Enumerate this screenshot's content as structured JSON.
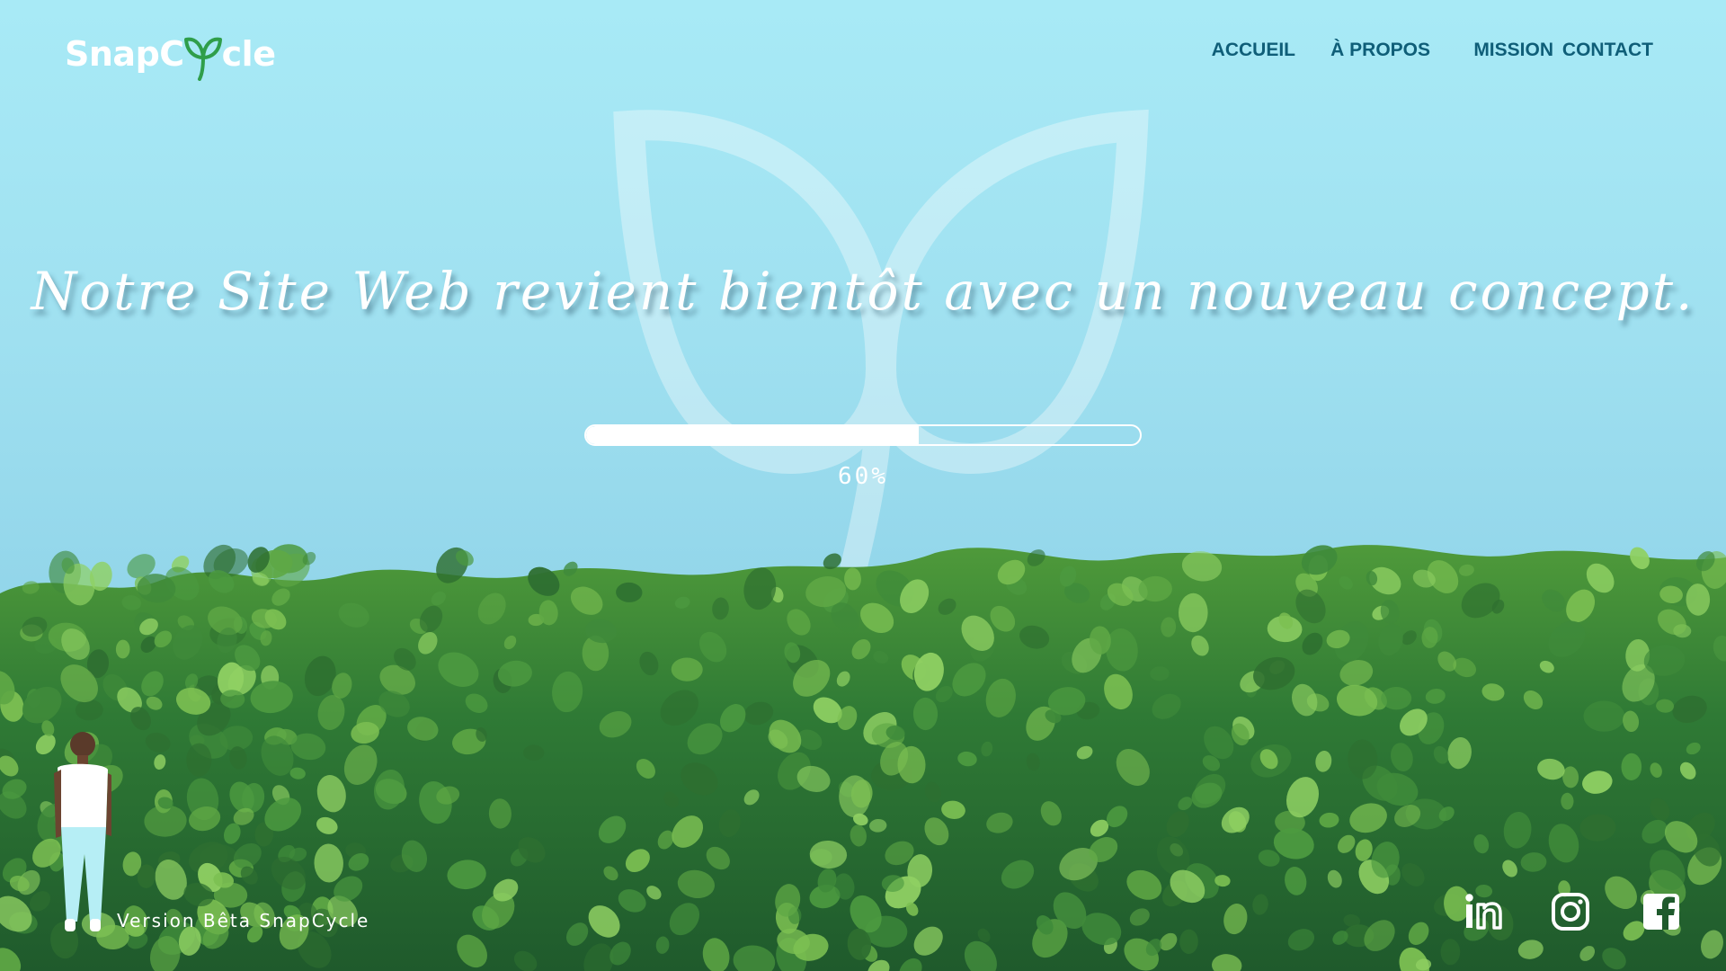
{
  "brand": {
    "logo_prefix": "SnapC",
    "logo_suffix": "cle",
    "logo_icon": "leaf-y-icon",
    "logo_accent": "#2f9e4a"
  },
  "nav": {
    "items": [
      {
        "label": "ACCUEIL"
      },
      {
        "label": "À PROPOS"
      },
      {
        "label": "MISSION"
      },
      {
        "label": "CONTACT"
      }
    ],
    "color": "#0f5e78"
  },
  "hero": {
    "headline": "Notre Site Web revient bientôt avec un nouveau concept.",
    "progress": {
      "value": 0.6,
      "label": "60%"
    }
  },
  "footer": {
    "version_text": "Version Bêta SnapCycle",
    "social": [
      {
        "icon": "linkedin-icon"
      },
      {
        "icon": "instagram-icon"
      },
      {
        "icon": "facebook-icon"
      }
    ]
  },
  "colors": {
    "sky_top": "#a8eaf6",
    "sky_bottom": "#8ccfe4",
    "foliage_dark": "#1f5a2c",
    "foliage_light": "#6fb24a"
  }
}
